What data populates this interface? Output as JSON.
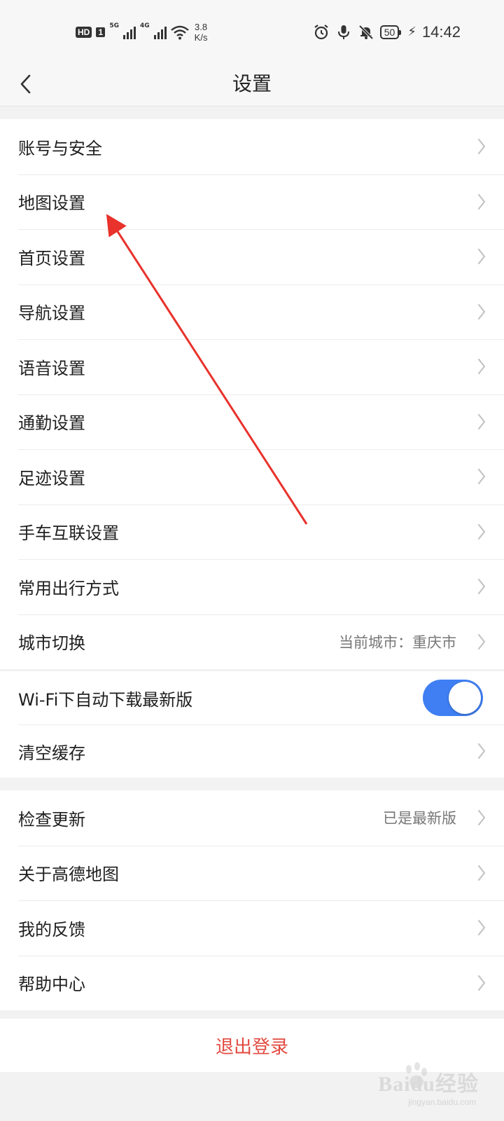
{
  "status_bar": {
    "hd_badge": "HD",
    "sim_badge": "1",
    "net1": "5G",
    "net2": "4G",
    "speed_value": "3.8",
    "speed_unit": "K/s",
    "battery": "50",
    "time": "14:42"
  },
  "header": {
    "title": "设置",
    "back_icon": "chevron-left-icon"
  },
  "groups": [
    {
      "items": [
        {
          "label": "账号与安全"
        },
        {
          "label": "地图设置"
        },
        {
          "label": "首页设置"
        },
        {
          "label": "导航设置"
        },
        {
          "label": "语音设置"
        },
        {
          "label": "通勤设置"
        },
        {
          "label": "足迹设置"
        },
        {
          "label": "手车互联设置"
        },
        {
          "label": "常用出行方式"
        },
        {
          "label": "城市切换",
          "value": "当前城市：重庆市"
        }
      ]
    },
    {
      "items": [
        {
          "label": "Wi-Fi下自动下载最新版",
          "toggle": "on"
        },
        {
          "label": "清空缓存"
        }
      ]
    },
    {
      "items": [
        {
          "label": "检查更新",
          "value": "已是最新版"
        },
        {
          "label": "关于高德地图"
        },
        {
          "label": "我的反馈"
        },
        {
          "label": "帮助中心"
        }
      ]
    }
  ],
  "logout": {
    "label": "退出登录"
  },
  "watermark": {
    "text": "Baidu经验",
    "sub": "jingyan.baidu.com"
  },
  "colors": {
    "accent": "#3f7ff3",
    "logout": "#e24a40",
    "annotation_arrow": "#e8322b"
  }
}
